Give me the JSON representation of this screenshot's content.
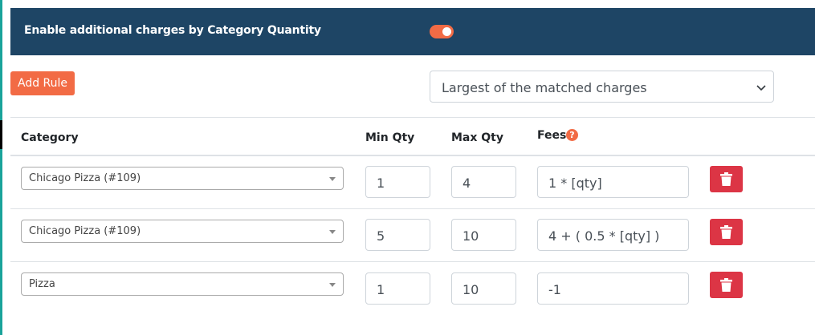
{
  "header": {
    "title": "Enable additional charges by Category Quantity",
    "toggle_on": true
  },
  "toolbar": {
    "add_rule_label": "Add Rule",
    "mode_select_value": "Largest of the matched charges"
  },
  "table": {
    "columns": {
      "category": "Category",
      "min_qty": "Min Qty",
      "max_qty": "Max Qty",
      "fees": "Fees",
      "fees_help": "?"
    },
    "rows": [
      {
        "category": "Chicago Pizza (#109)",
        "min": "1",
        "max": "4",
        "fee": "1 * [qty]"
      },
      {
        "category": "Chicago Pizza (#109)",
        "min": "5",
        "max": "10",
        "fee": "4 + ( 0.5 * [qty] )"
      },
      {
        "category": "Pizza",
        "min": "1",
        "max": "10",
        "fee": "-1"
      }
    ]
  },
  "colors": {
    "header_bg": "#1e4565",
    "accent": "#f26b45",
    "delete": "#dc3545"
  },
  "icons": {
    "toggle": "toggle-switch-icon",
    "help": "question-circle-icon",
    "delete": "trash-icon",
    "dropdown": "chevron-down-icon"
  }
}
